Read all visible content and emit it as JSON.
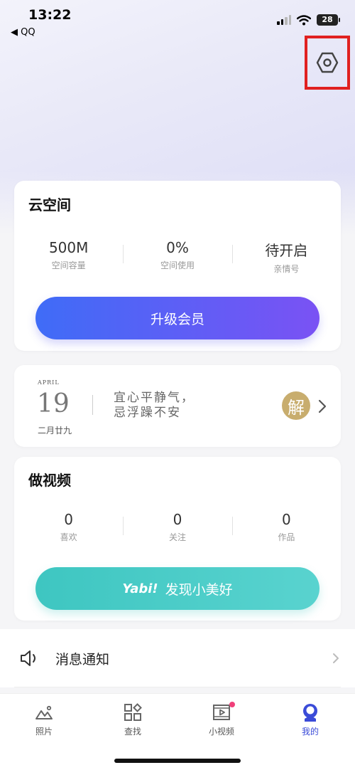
{
  "status_bar": {
    "time": "13:22",
    "back_app": "◀ QQ",
    "battery": "28"
  },
  "cloud": {
    "title": "云空间",
    "stats": [
      {
        "value": "500M",
        "label": "空间容量"
      },
      {
        "value": "0%",
        "label": "空间使用"
      },
      {
        "value": "待开启",
        "label": "亲情号"
      }
    ],
    "upgrade_label": "升级会员"
  },
  "calendar": {
    "month": "APRIL",
    "day": "19",
    "lunar": "二月廿九",
    "line1": "宜心平静气，",
    "line2": "忌浮躁不安",
    "badge": "解"
  },
  "video": {
    "title": "做视频",
    "stats": [
      {
        "value": "0",
        "label": "喜欢"
      },
      {
        "value": "0",
        "label": "关注"
      },
      {
        "value": "0",
        "label": "作品"
      }
    ],
    "yabi_logo": "Yabi!",
    "discover_label": "发现小美好"
  },
  "notice": {
    "label": "消息通知"
  },
  "tabs": [
    {
      "label": "照片",
      "icon": "photos-icon"
    },
    {
      "label": "查找",
      "icon": "find-icon"
    },
    {
      "label": "小视频",
      "icon": "video-icon"
    },
    {
      "label": "我的",
      "icon": "profile-icon"
    }
  ],
  "colors": {
    "accent": "#3a4bd8",
    "upgrade_gradient_start": "#3f6cf7",
    "upgrade_gradient_end": "#7a52f4",
    "yabi_teal": "#3ec6c1",
    "badge_gold": "#c8ad6e",
    "highlight_red": "#e02020",
    "notification_dot": "#f0407a"
  }
}
